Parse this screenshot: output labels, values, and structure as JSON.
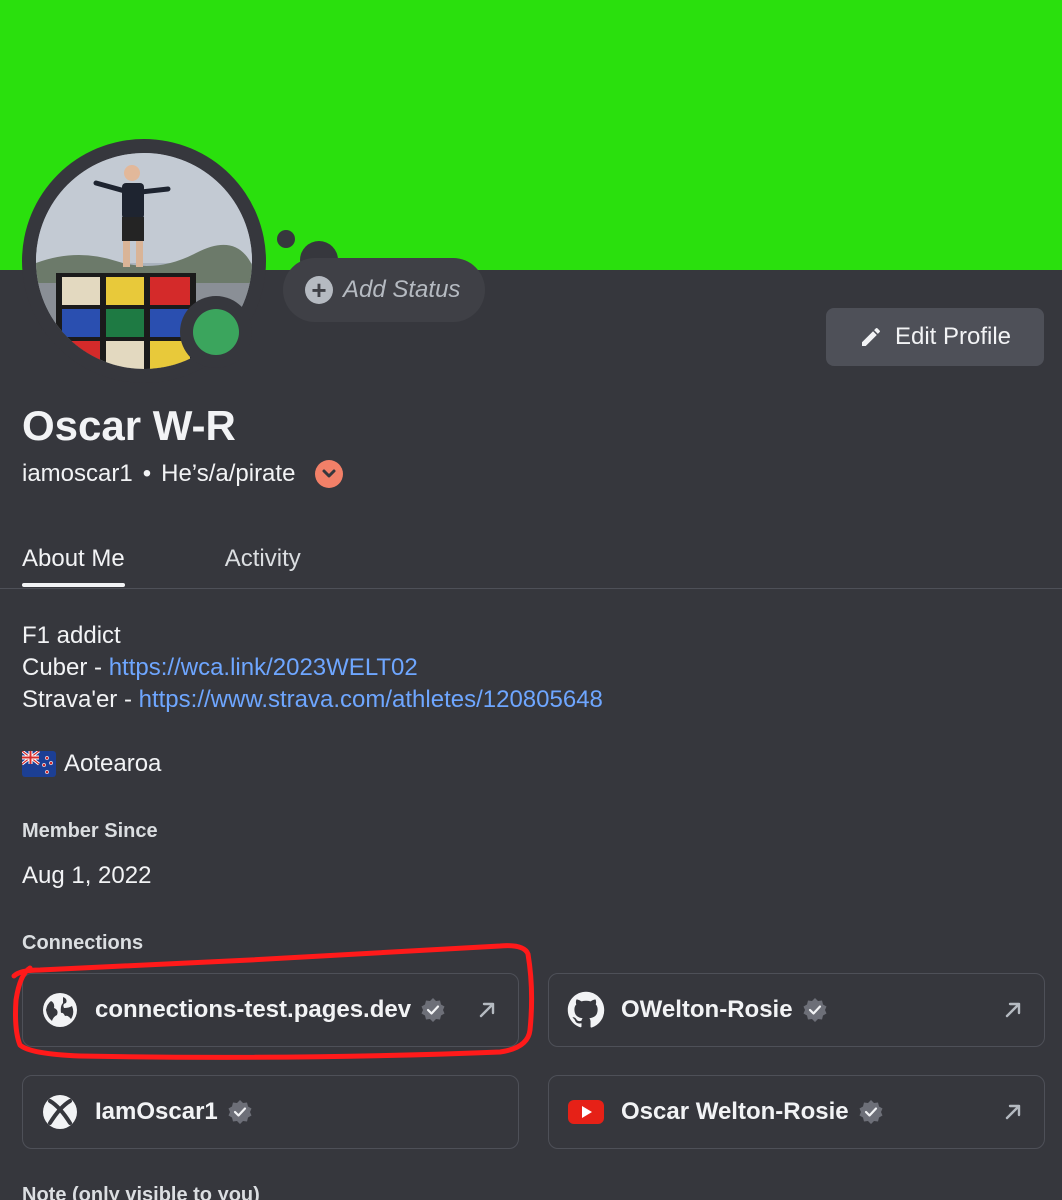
{
  "colors": {
    "banner": "#2ae00d",
    "background": "#36373d",
    "link": "#6ea6ff",
    "online": "#3ba55d",
    "highlight_annotation": "#ff0000"
  },
  "status": {
    "add_status_label": "Add Status",
    "presence": "online"
  },
  "header": {
    "edit_profile_label": "Edit Profile"
  },
  "profile": {
    "display_name": "Oscar W-R",
    "username": "iamoscar1",
    "separator": "•",
    "pronouns": "He’s/a/pirate"
  },
  "tabs": [
    {
      "label": "About Me",
      "active": true
    },
    {
      "label": "Activity",
      "active": false
    }
  ],
  "bio": {
    "line1": "F1 addict",
    "line2_prefix": "Cuber - ",
    "line2_link": "https://wca.link/2023WELT02",
    "line3_prefix": "Strava'er - ",
    "line3_link": "https://www.strava.com/athletes/120805648",
    "location_flag": "nz-flag-icon",
    "location": "Aotearoa"
  },
  "member_since": {
    "title": "Member Since",
    "date": "Aug 1, 2022"
  },
  "connections": {
    "title": "Connections",
    "items": [
      {
        "name": "connections-test.pages.dev",
        "service": "globe-icon",
        "verified": true,
        "external": true
      },
      {
        "name": "OWelton-Rosie",
        "service": "github-icon",
        "verified": true,
        "external": true
      },
      {
        "name": "IamOscar1",
        "service": "xbox-icon",
        "verified": true,
        "external": false
      },
      {
        "name": "Oscar Welton-Rosie",
        "service": "youtube-icon",
        "verified": true,
        "external": true
      }
    ]
  },
  "note": {
    "title": "Note (only visible to you)"
  }
}
